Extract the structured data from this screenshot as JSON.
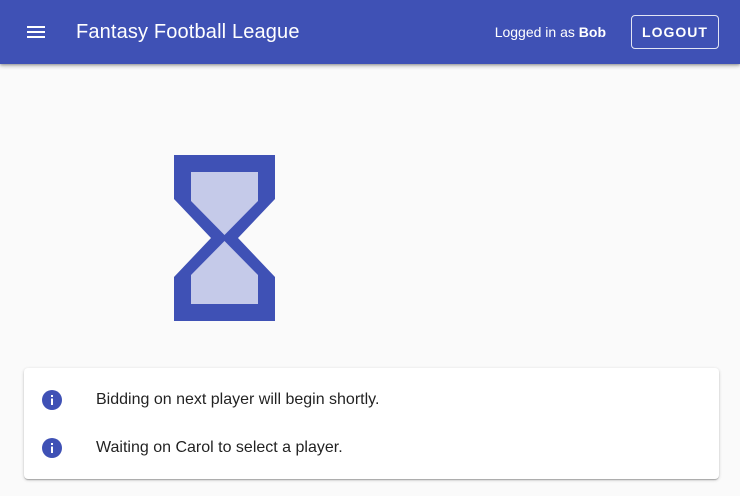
{
  "app_bar": {
    "title": "Fantasy Football League",
    "logged_in_prefix": "Logged in as",
    "username": "Bob",
    "logout_label": "LOGOUT",
    "background_color": "#3f51b5",
    "menu_icon": "menu-icon"
  },
  "main": {
    "status_icon": "hourglass-icon",
    "status_icon_colors": {
      "frame": "#3f51b5",
      "sand": "#c5cae9"
    }
  },
  "info_card": {
    "items": [
      {
        "icon": "info-icon",
        "text": "Bidding on next player will begin shortly."
      },
      {
        "icon": "info-icon",
        "text": "Waiting on Carol to select a player."
      }
    ],
    "icon_color": "#3f51b5"
  }
}
